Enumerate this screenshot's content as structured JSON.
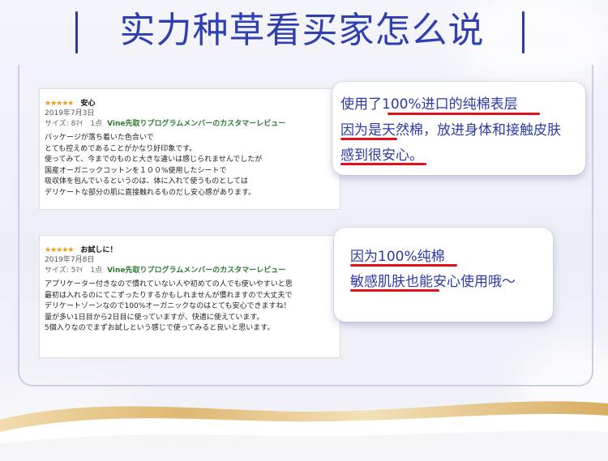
{
  "title": "实力种草看买家怎么说",
  "colors": {
    "title": "#2f3fb0",
    "accent_underline": "#e3101c",
    "stars": "#f29a11",
    "vine_green": "#2d7b33",
    "ribbon_gold": "#e8c98c"
  },
  "review1": {
    "stars": "★★★★★",
    "title": "安心",
    "date": "2019年7月3日",
    "meta": "サイズ: 8ﾏｲ　1点",
    "vine": "Vine先取りプログラムメンバーのカスタマーレビュー",
    "lines": [
      "パッケージが落ち着いた色合いで",
      "とても控えめであることがかなり好印象です。",
      "使ってみて、今までのものと大きな違いは感じられませんでしたが",
      "国産オーガニックコットンを１００%使用したシートで",
      "吸収体を包んでいるというのは、体に入れて使うものとしては",
      "デリケートな部分の肌に直接触れるものだし安心感があります。"
    ]
  },
  "review2": {
    "stars": "★★★★★",
    "title": "お試しに！",
    "date": "2019年7月8日",
    "meta": "サイズ: 5ﾏｲ　1点",
    "vine": "Vine先取りプログラムメンバーのカスタマーレビュー",
    "lines": [
      "アプリケーター付きなので慣れていない人や初めての人でも使いやすいと思",
      "最初は入れるのにてこずったりするかもしれませんが慣れますので大丈夫で",
      "デリケートゾーンなので100%オーガニックなのはとても安心できますね！",
      "量が多い1日目から2日目に使っていますが、快適に使えています。",
      "5個入りなのでまずお試しという感じで使ってみると良いと思います。"
    ]
  },
  "callout1": {
    "line1": "使用了100%进口的纯棉表层",
    "line2": "因为是天然棉，放进身体和接触皮肤",
    "line3": "感到很安心。"
  },
  "callout2": {
    "line1": "因为100%纯棉",
    "line2": "敏感肌肤也能安心使用哦～"
  }
}
